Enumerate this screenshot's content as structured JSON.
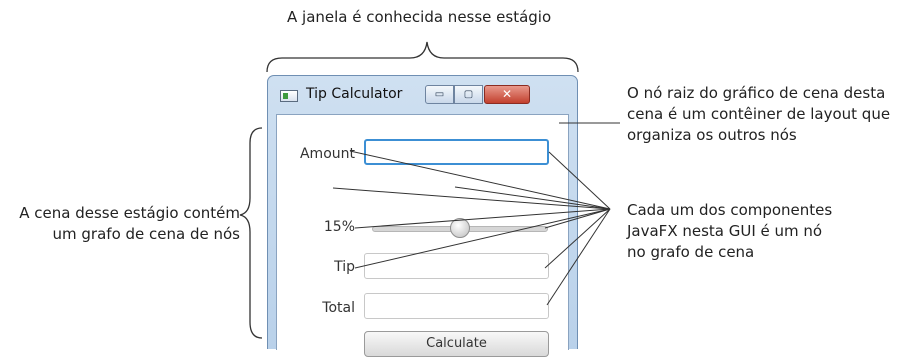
{
  "annotations": {
    "top": "A janela é conhecida nesse estágio",
    "root_line1": "O nó raiz do gráfico de cena desta",
    "root_line2": "cena é um contêiner de layout que",
    "root_line3": "organiza os outros nós",
    "comp_line1": "Cada um dos componentes",
    "comp_line2": "JavaFX nesta GUI é um nó",
    "comp_line3": "no grafo de cena",
    "scene_line1": "A cena desse estágio contém",
    "scene_line2": "um grafo de cena de nós"
  },
  "window": {
    "title": "Tip Calculator",
    "minimize_glyph": "▭",
    "maximize_glyph": "▢",
    "close_glyph": "✕",
    "icon": "app-window-icon"
  },
  "form": {
    "amount_label": "Amount",
    "amount_value": "",
    "percent_label": "15%",
    "slider_value": 0.15,
    "slider_min": 0,
    "slider_max": 0.3,
    "tip_label": "Tip",
    "tip_value": "",
    "total_label": "Total",
    "total_value": "",
    "calculate_label": "Calculate"
  }
}
